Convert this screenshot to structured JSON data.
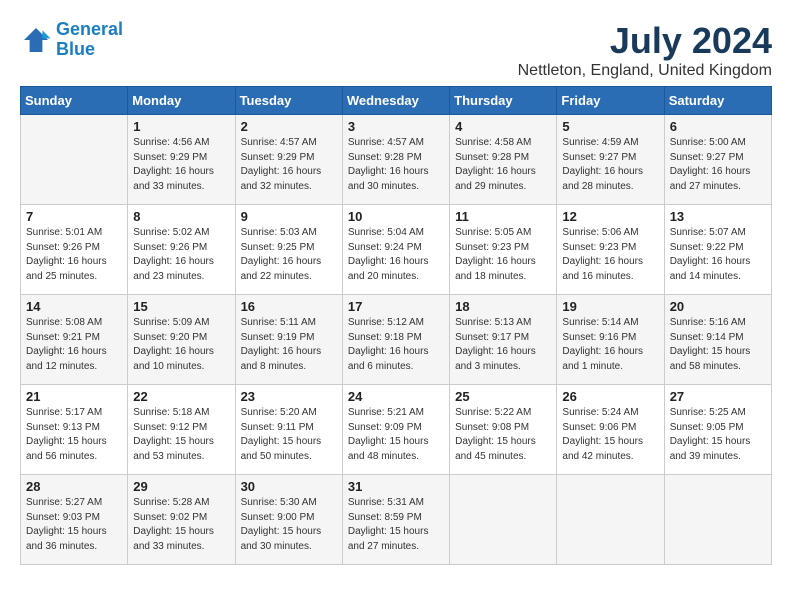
{
  "header": {
    "logo_line1": "General",
    "logo_line2": "Blue",
    "month_year": "July 2024",
    "location": "Nettleton, England, United Kingdom"
  },
  "weekdays": [
    "Sunday",
    "Monday",
    "Tuesday",
    "Wednesday",
    "Thursday",
    "Friday",
    "Saturday"
  ],
  "weeks": [
    [
      {
        "day": "",
        "sunrise": "",
        "sunset": "",
        "daylight": ""
      },
      {
        "day": "1",
        "sunrise": "Sunrise: 4:56 AM",
        "sunset": "Sunset: 9:29 PM",
        "daylight": "Daylight: 16 hours and 33 minutes."
      },
      {
        "day": "2",
        "sunrise": "Sunrise: 4:57 AM",
        "sunset": "Sunset: 9:29 PM",
        "daylight": "Daylight: 16 hours and 32 minutes."
      },
      {
        "day": "3",
        "sunrise": "Sunrise: 4:57 AM",
        "sunset": "Sunset: 9:28 PM",
        "daylight": "Daylight: 16 hours and 30 minutes."
      },
      {
        "day": "4",
        "sunrise": "Sunrise: 4:58 AM",
        "sunset": "Sunset: 9:28 PM",
        "daylight": "Daylight: 16 hours and 29 minutes."
      },
      {
        "day": "5",
        "sunrise": "Sunrise: 4:59 AM",
        "sunset": "Sunset: 9:27 PM",
        "daylight": "Daylight: 16 hours and 28 minutes."
      },
      {
        "day": "6",
        "sunrise": "Sunrise: 5:00 AM",
        "sunset": "Sunset: 9:27 PM",
        "daylight": "Daylight: 16 hours and 27 minutes."
      }
    ],
    [
      {
        "day": "7",
        "sunrise": "Sunrise: 5:01 AM",
        "sunset": "Sunset: 9:26 PM",
        "daylight": "Daylight: 16 hours and 25 minutes."
      },
      {
        "day": "8",
        "sunrise": "Sunrise: 5:02 AM",
        "sunset": "Sunset: 9:26 PM",
        "daylight": "Daylight: 16 hours and 23 minutes."
      },
      {
        "day": "9",
        "sunrise": "Sunrise: 5:03 AM",
        "sunset": "Sunset: 9:25 PM",
        "daylight": "Daylight: 16 hours and 22 minutes."
      },
      {
        "day": "10",
        "sunrise": "Sunrise: 5:04 AM",
        "sunset": "Sunset: 9:24 PM",
        "daylight": "Daylight: 16 hours and 20 minutes."
      },
      {
        "day": "11",
        "sunrise": "Sunrise: 5:05 AM",
        "sunset": "Sunset: 9:23 PM",
        "daylight": "Daylight: 16 hours and 18 minutes."
      },
      {
        "day": "12",
        "sunrise": "Sunrise: 5:06 AM",
        "sunset": "Sunset: 9:23 PM",
        "daylight": "Daylight: 16 hours and 16 minutes."
      },
      {
        "day": "13",
        "sunrise": "Sunrise: 5:07 AM",
        "sunset": "Sunset: 9:22 PM",
        "daylight": "Daylight: 16 hours and 14 minutes."
      }
    ],
    [
      {
        "day": "14",
        "sunrise": "Sunrise: 5:08 AM",
        "sunset": "Sunset: 9:21 PM",
        "daylight": "Daylight: 16 hours and 12 minutes."
      },
      {
        "day": "15",
        "sunrise": "Sunrise: 5:09 AM",
        "sunset": "Sunset: 9:20 PM",
        "daylight": "Daylight: 16 hours and 10 minutes."
      },
      {
        "day": "16",
        "sunrise": "Sunrise: 5:11 AM",
        "sunset": "Sunset: 9:19 PM",
        "daylight": "Daylight: 16 hours and 8 minutes."
      },
      {
        "day": "17",
        "sunrise": "Sunrise: 5:12 AM",
        "sunset": "Sunset: 9:18 PM",
        "daylight": "Daylight: 16 hours and 6 minutes."
      },
      {
        "day": "18",
        "sunrise": "Sunrise: 5:13 AM",
        "sunset": "Sunset: 9:17 PM",
        "daylight": "Daylight: 16 hours and 3 minutes."
      },
      {
        "day": "19",
        "sunrise": "Sunrise: 5:14 AM",
        "sunset": "Sunset: 9:16 PM",
        "daylight": "Daylight: 16 hours and 1 minute."
      },
      {
        "day": "20",
        "sunrise": "Sunrise: 5:16 AM",
        "sunset": "Sunset: 9:14 PM",
        "daylight": "Daylight: 15 hours and 58 minutes."
      }
    ],
    [
      {
        "day": "21",
        "sunrise": "Sunrise: 5:17 AM",
        "sunset": "Sunset: 9:13 PM",
        "daylight": "Daylight: 15 hours and 56 minutes."
      },
      {
        "day": "22",
        "sunrise": "Sunrise: 5:18 AM",
        "sunset": "Sunset: 9:12 PM",
        "daylight": "Daylight: 15 hours and 53 minutes."
      },
      {
        "day": "23",
        "sunrise": "Sunrise: 5:20 AM",
        "sunset": "Sunset: 9:11 PM",
        "daylight": "Daylight: 15 hours and 50 minutes."
      },
      {
        "day": "24",
        "sunrise": "Sunrise: 5:21 AM",
        "sunset": "Sunset: 9:09 PM",
        "daylight": "Daylight: 15 hours and 48 minutes."
      },
      {
        "day": "25",
        "sunrise": "Sunrise: 5:22 AM",
        "sunset": "Sunset: 9:08 PM",
        "daylight": "Daylight: 15 hours and 45 minutes."
      },
      {
        "day": "26",
        "sunrise": "Sunrise: 5:24 AM",
        "sunset": "Sunset: 9:06 PM",
        "daylight": "Daylight: 15 hours and 42 minutes."
      },
      {
        "day": "27",
        "sunrise": "Sunrise: 5:25 AM",
        "sunset": "Sunset: 9:05 PM",
        "daylight": "Daylight: 15 hours and 39 minutes."
      }
    ],
    [
      {
        "day": "28",
        "sunrise": "Sunrise: 5:27 AM",
        "sunset": "Sunset: 9:03 PM",
        "daylight": "Daylight: 15 hours and 36 minutes."
      },
      {
        "day": "29",
        "sunrise": "Sunrise: 5:28 AM",
        "sunset": "Sunset: 9:02 PM",
        "daylight": "Daylight: 15 hours and 33 minutes."
      },
      {
        "day": "30",
        "sunrise": "Sunrise: 5:30 AM",
        "sunset": "Sunset: 9:00 PM",
        "daylight": "Daylight: 15 hours and 30 minutes."
      },
      {
        "day": "31",
        "sunrise": "Sunrise: 5:31 AM",
        "sunset": "Sunset: 8:59 PM",
        "daylight": "Daylight: 15 hours and 27 minutes."
      },
      {
        "day": "",
        "sunrise": "",
        "sunset": "",
        "daylight": ""
      },
      {
        "day": "",
        "sunrise": "",
        "sunset": "",
        "daylight": ""
      },
      {
        "day": "",
        "sunrise": "",
        "sunset": "",
        "daylight": ""
      }
    ]
  ]
}
